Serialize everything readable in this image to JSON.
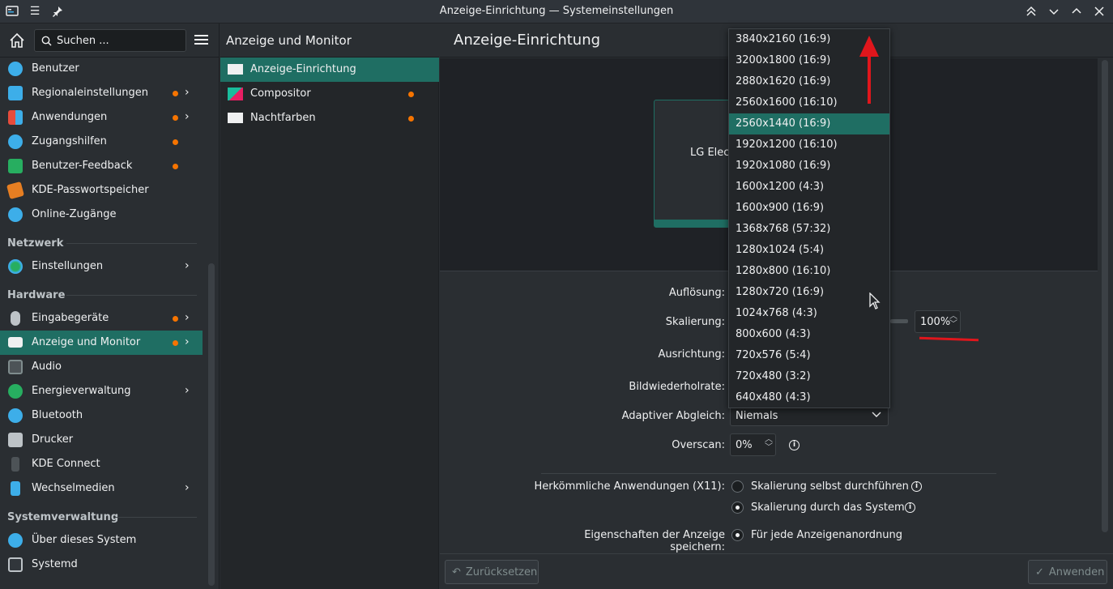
{
  "window": {
    "title": "Anzeige-Einrichtung — Systemeinstellungen"
  },
  "sidebar": {
    "search_placeholder": "Suchen ...",
    "items": [
      {
        "label": "Benutzer",
        "dot": false,
        "chevron": false
      },
      {
        "label": "Regionaleinstellungen",
        "dot": true,
        "chevron": true
      },
      {
        "label": "Anwendungen",
        "dot": true,
        "chevron": true
      },
      {
        "label": "Zugangshilfen",
        "dot": true,
        "chevron": false
      },
      {
        "label": "Benutzer-Feedback",
        "dot": true,
        "chevron": false
      },
      {
        "label": "KDE-Passwortspeicher",
        "dot": false,
        "chevron": false
      },
      {
        "label": "Online-Zugänge",
        "dot": false,
        "chevron": false
      }
    ],
    "section_network": "Netzwerk",
    "network_items": [
      {
        "label": "Einstellungen",
        "chevron": true
      }
    ],
    "section_hardware": "Hardware",
    "hardware_items": [
      {
        "label": "Eingabegeräte",
        "dot": true,
        "chevron": true
      },
      {
        "label": "Anzeige und Monitor",
        "dot": true,
        "chevron": true,
        "active": true
      },
      {
        "label": "Audio"
      },
      {
        "label": "Energieverwaltung",
        "chevron": true
      },
      {
        "label": "Bluetooth"
      },
      {
        "label": "Drucker"
      },
      {
        "label": "KDE Connect"
      },
      {
        "label": "Wechselmedien",
        "chevron": true
      }
    ],
    "section_system": "Systemverwaltung",
    "system_items": [
      {
        "label": "Über dieses System"
      },
      {
        "label": "Systemd"
      }
    ]
  },
  "midcol": {
    "title": "Anzeige und Monitor",
    "items": [
      {
        "label": "Anzeige-Einrichtung",
        "active": true,
        "dot": false
      },
      {
        "label": "Compositor",
        "dot": true
      },
      {
        "label": "Nachtfarben",
        "dot": true
      }
    ]
  },
  "main": {
    "title": "Anzeige-Einrichtung",
    "monitor_name": "LG Elect",
    "labels": {
      "resolution": "Auflösung:",
      "scaling": "Skalierung:",
      "orientation": "Ausrichtung:",
      "refresh": "Bildwiederholrate:",
      "adaptive": "Adaptiver Abgleich:",
      "overscan": "Overscan:",
      "legacy": "Herkömmliche Anwendungen (X11):",
      "save_props": "Eigenschaften der Anzeige speichern:"
    },
    "scaling_value": "100%",
    "adaptive_value": "Niemals",
    "overscan_value": "0%",
    "legacy_options": [
      {
        "label": "Skalierung selbst durchführen",
        "checked": false
      },
      {
        "label": "Skalierung durch das System",
        "checked": true
      }
    ],
    "save_options": [
      {
        "label": "Für jede Anzeigenanordnung",
        "checked": true
      }
    ],
    "reset_label": "Zurücksetzen",
    "apply_label": "Anwenden"
  },
  "resolution_dropdown": {
    "selected_index": 4,
    "options": [
      "3840x2160 (16:9)",
      "3200x1800 (16:9)",
      "2880x1620 (16:9)",
      "2560x1600 (16:10)",
      "2560x1440 (16:9)",
      "1920x1200 (16:10)",
      "1920x1080 (16:9)",
      "1600x1200 (4:3)",
      "1600x900 (16:9)",
      "1368x768 (57:32)",
      "1280x1024 (5:4)",
      "1280x800 (16:10)",
      "1280x720 (16:9)",
      "1024x768 (4:3)",
      "800x600 (4:3)",
      "720x576 (5:4)",
      "720x480 (3:2)",
      "640x480 (4:3)"
    ]
  },
  "colors": {
    "accent": "#1f6e63",
    "notify_dot": "#f67400",
    "annotation": "#e0161c"
  }
}
